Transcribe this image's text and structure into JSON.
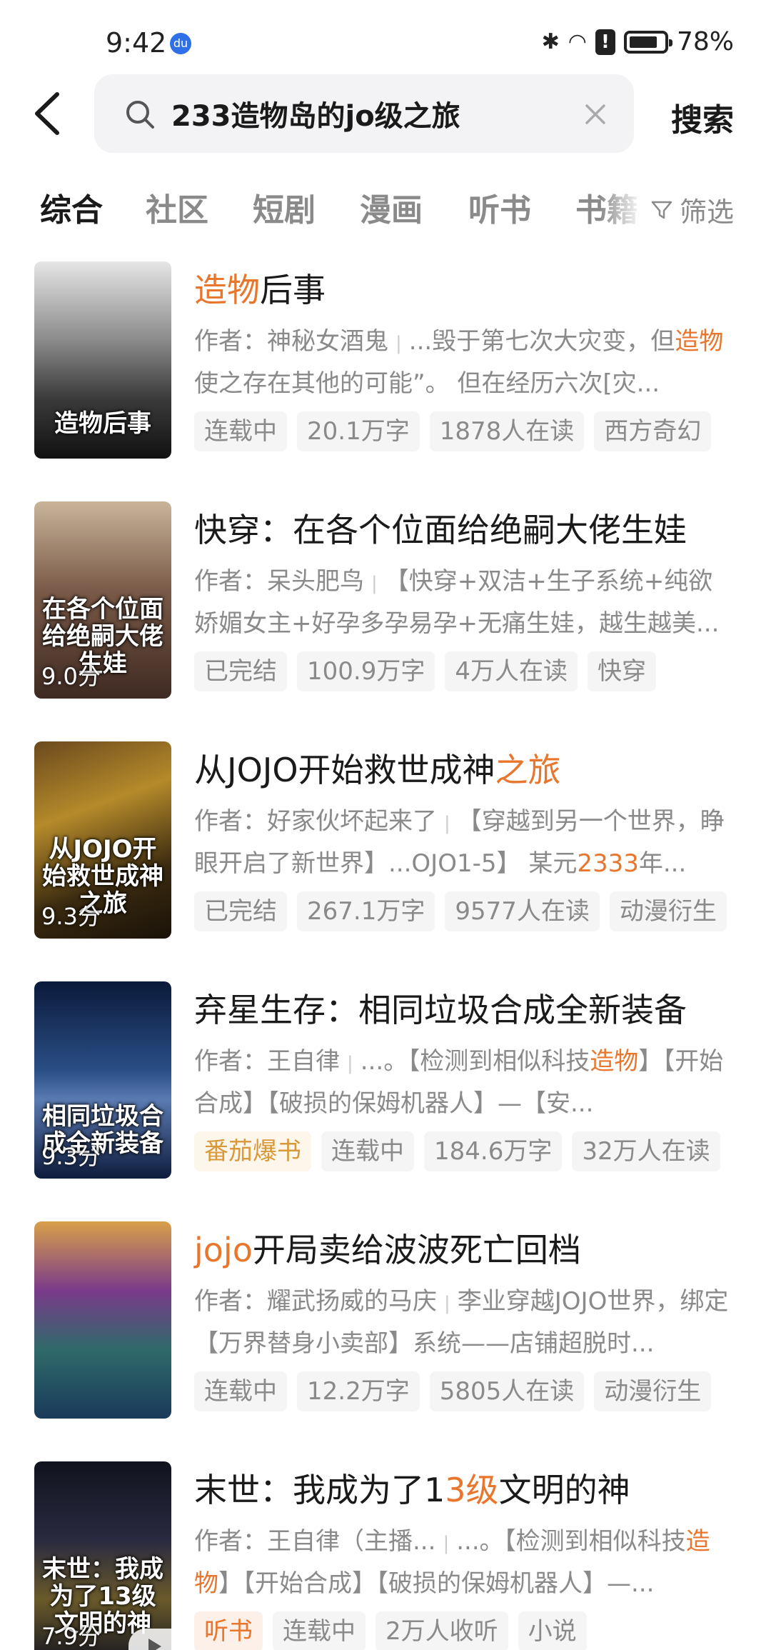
{
  "status": {
    "time": "9:42",
    "battery": "78%"
  },
  "search": {
    "query": "233造物岛的jo级之旅",
    "button": "搜索"
  },
  "tabs": [
    "综合",
    "社区",
    "短剧",
    "漫画",
    "听书",
    "书籍"
  ],
  "filter_label": "筛选",
  "books": [
    {
      "title": [
        {
          "t": "造物",
          "h": true
        },
        {
          "t": "后事",
          "h": false
        }
      ],
      "author": "作者：神秘女酒鬼",
      "desc": [
        {
          "t": "...毁于第七次大灾变，但",
          "h": false
        },
        {
          "t": "造物",
          "h": true
        },
        {
          "t": "使之存在其他的可能”。    但在经历六次[灾...",
          "h": false
        }
      ],
      "tags": [
        {
          "t": "连载中",
          "s": ""
        },
        {
          "t": "20.1万字",
          "s": ""
        },
        {
          "t": "1878人在读",
          "s": ""
        },
        {
          "t": "西方奇幻",
          "s": ""
        }
      ],
      "cover_text": "造物后事",
      "score": "",
      "cover_bg": "linear-gradient(180deg,#e6e6e6 0%,#8a8a8a 40%,#3a3a3a 70%,#111 100%)"
    },
    {
      "title": [
        {
          "t": "快穿：在各个位面给绝嗣大佬生娃",
          "h": false
        }
      ],
      "author": "作者：呆头肥鸟",
      "desc": [
        {
          "t": "【快穿+双洁+生子系统+纯欲娇媚女主+好孕多孕易孕+无痛生娃，越生越美...",
          "h": false
        }
      ],
      "tags": [
        {
          "t": "已完结",
          "s": ""
        },
        {
          "t": "100.9万字",
          "s": ""
        },
        {
          "t": "4万人在读",
          "s": ""
        },
        {
          "t": "快穿",
          "s": ""
        }
      ],
      "cover_text": "在各个位面给绝嗣大佬生娃",
      "score": "9.0分",
      "cover_bg": "linear-gradient(180deg,#c9b49a 0%,#7a5a48 45%,#3e2a22 100%)"
    },
    {
      "title": [
        {
          "t": "从JOJO开始救世成神",
          "h": false
        },
        {
          "t": "之旅",
          "h": true
        }
      ],
      "author": "作者：好家伙坏起来了",
      "desc": [
        {
          "t": "【穿越到另一个世界，睁眼开启了新世界】...OJO1-5】 某元",
          "h": false
        },
        {
          "t": "2333",
          "h": true
        },
        {
          "t": "年...",
          "h": false
        }
      ],
      "tags": [
        {
          "t": "已完结",
          "s": ""
        },
        {
          "t": "267.1万字",
          "s": ""
        },
        {
          "t": "9577人在读",
          "s": ""
        },
        {
          "t": "动漫衍生",
          "s": ""
        }
      ],
      "cover_text": "从JOJO开始救世成神之旅",
      "score": "9.3分",
      "cover_bg": "linear-gradient(160deg,#6b4a1e 0%,#b58a2a 35%,#3a2a10 70%,#1a1208 100%)"
    },
    {
      "title": [
        {
          "t": "弃星生存：相同垃圾合成全新装备",
          "h": false
        }
      ],
      "author": "作者：王自律",
      "desc": [
        {
          "t": "...。【检测到相似科技",
          "h": false
        },
        {
          "t": "造物",
          "h": true
        },
        {
          "t": "】【开始合成】【破损的保姆机器人】—【安...",
          "h": false
        }
      ],
      "tags": [
        {
          "t": "番茄爆书",
          "s": "gold"
        },
        {
          "t": "连载中",
          "s": ""
        },
        {
          "t": "184.6万字",
          "s": ""
        },
        {
          "t": "32万人在读",
          "s": ""
        }
      ],
      "cover_text": "相同垃圾合成全新装备",
      "score": "9.3分",
      "cover_bg": "linear-gradient(180deg,#0b1a3a 0%,#2a4e86 45%,#5a7ab2 60%,#0e1c3c 100%)"
    },
    {
      "title": [
        {
          "t": "jojo",
          "h": true
        },
        {
          "t": "开局卖给波波死亡回档",
          "h": false
        }
      ],
      "author": "作者：耀武扬威的马庆",
      "desc": [
        {
          "t": "李业穿越JOJO世界，绑定【万界替身小卖部】系统——店铺超脱时...",
          "h": false
        }
      ],
      "tags": [
        {
          "t": "连载中",
          "s": ""
        },
        {
          "t": "12.2万字",
          "s": ""
        },
        {
          "t": "5805人在读",
          "s": ""
        },
        {
          "t": "动漫衍生",
          "s": ""
        }
      ],
      "cover_text": "",
      "score": "",
      "cover_bg": "linear-gradient(180deg,#d8a04a 0%,#7a3a8a 35%,#2f6a6a 65%,#1a3a5a 100%)"
    },
    {
      "title": [
        {
          "t": "末世：我成为了1",
          "h": false
        },
        {
          "t": "3级",
          "h": true
        },
        {
          "t": "文明的神",
          "h": false
        }
      ],
      "author": "作者：王自律（主播...",
      "desc": [
        {
          "t": "...。【检测到相似科技",
          "h": false
        },
        {
          "t": "造物",
          "h": true
        },
        {
          "t": "】【开始合成】【破损的保姆机器人】—...",
          "h": false
        }
      ],
      "tags": [
        {
          "t": "听书",
          "s": "orange"
        },
        {
          "t": "连载中",
          "s": ""
        },
        {
          "t": "2万人收听",
          "s": ""
        },
        {
          "t": "小说",
          "s": ""
        }
      ],
      "cover_text": "末世：我成为了13级文明的神",
      "score": "7.9分",
      "cover_bg": "linear-gradient(180deg,#10131e 0%,#2a2a40 40%,#6a5a2a 70%,#1a1a22 100%)"
    }
  ]
}
